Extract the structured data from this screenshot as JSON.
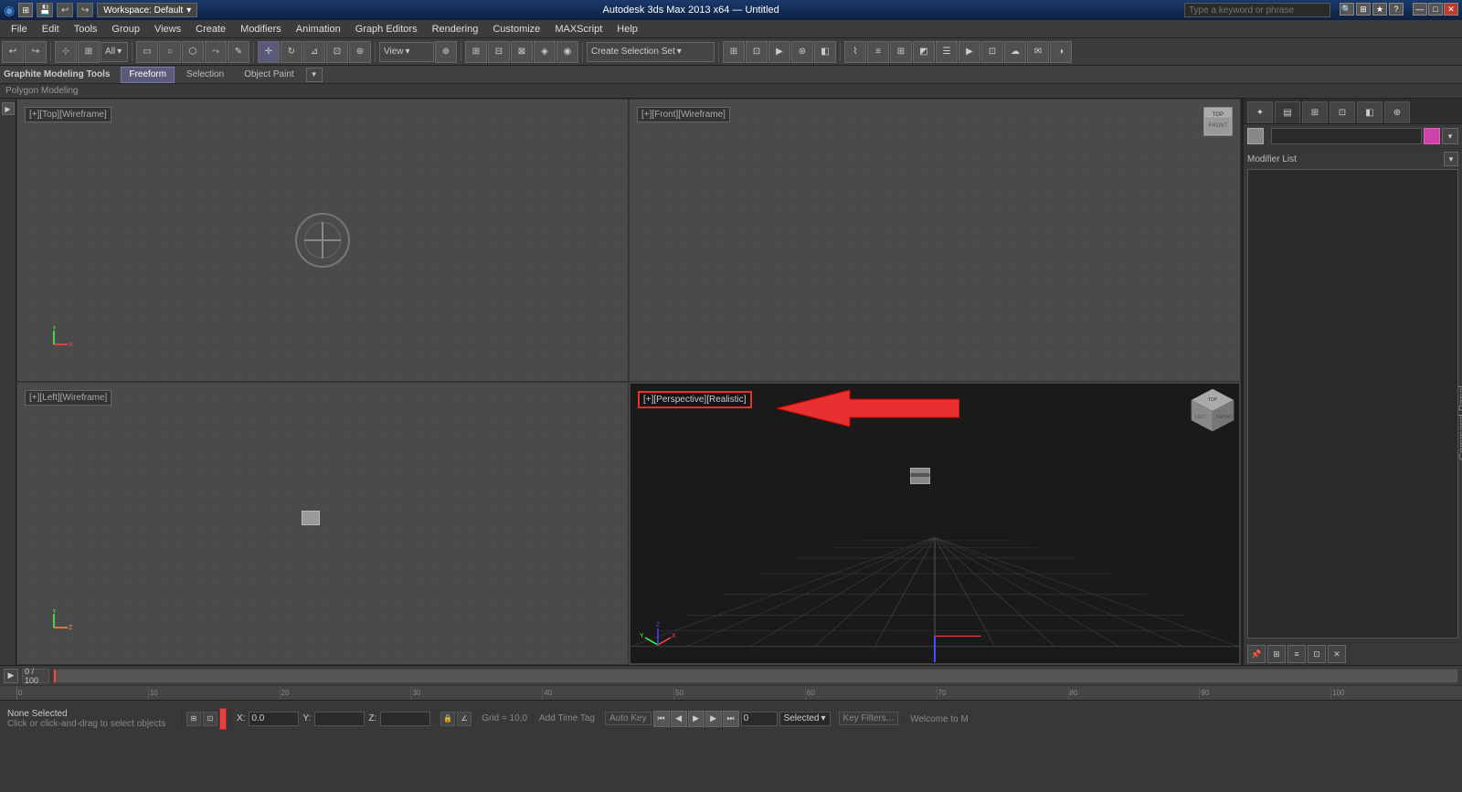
{
  "titlebar": {
    "logo": "◉",
    "title": "Autodesk 3ds Max 2013 x64 — Untitled",
    "workspace_label": "Workspace: Default",
    "search_placeholder": "Type a keyword or phrase",
    "controls": [
      "—",
      "□",
      "✕"
    ]
  },
  "menu": {
    "items": [
      "File",
      "Edit",
      "Tools",
      "Group",
      "Views",
      "Create",
      "Modifiers",
      "Animation",
      "Graph Editors",
      "Rendering",
      "Customize",
      "MAXScript",
      "Help"
    ]
  },
  "toolbar": {
    "view_dropdown": "View",
    "view_dropdown2": "All",
    "create_dropdown": "Create Selection Set",
    "buttons": [
      "undo",
      "redo",
      "select",
      "select-region",
      "lasso",
      "paint",
      "move",
      "rotate",
      "scale",
      "uniform-scale",
      "select-center",
      "coord-system",
      "use-transform-center",
      "mirror",
      "align",
      "quick-align",
      "normal-align",
      "place-highlight",
      "snap-angle",
      "snap-percent",
      "named-selections",
      "curve",
      "sound",
      "effects",
      "rendering",
      "environment",
      "material-editor",
      "render-scene",
      "quick-render"
    ]
  },
  "secondary_toolbar": {
    "title": "Graphite Modeling Tools",
    "tabs": [
      "Freeform",
      "Selection",
      "Object Paint"
    ],
    "extra_btn": "▾"
  },
  "polygon_label": "Polygon Modeling",
  "viewports": {
    "top": {
      "label": "[+][Top][Wireframe]",
      "has_object": false
    },
    "front": {
      "label": "[+][Front][Wireframe]",
      "has_object": false
    },
    "left": {
      "label": "[+][Left][Wireframe]",
      "has_small_obj": true
    },
    "perspective": {
      "label": "[+][Perspective][Realistic]",
      "highlighted": true,
      "has_grid": true
    }
  },
  "annotation": {
    "arrow_text": "←",
    "label": "Command Panel"
  },
  "command_panel": {
    "label": "Command Panel",
    "tabs": [
      "create",
      "modify",
      "hierarchy",
      "motion",
      "display",
      "utilities"
    ],
    "tab_icons": [
      "✦",
      "▤",
      "⊞",
      "⊡",
      "◧",
      "⊕"
    ],
    "modifier_list_label": "Modifier List",
    "color_swatches": [
      "#888888",
      "#ff44aa"
    ]
  },
  "timeline": {
    "current_frame": "0 / 100",
    "start": "0",
    "end": "100"
  },
  "ruler": {
    "marks": [
      "0",
      "10",
      "20",
      "30",
      "40",
      "50",
      "60",
      "70",
      "80",
      "90",
      "100"
    ]
  },
  "status_bar": {
    "selection_label": "None Selected",
    "hint": "Click or click-and-drag to select objects",
    "coords": {
      "x_label": "X:",
      "x_value": "0.0",
      "y_label": "Y:",
      "y_value": "",
      "z_label": "Z:",
      "z_value": ""
    },
    "grid_label": "Grid = 10,0",
    "autokey_label": "Auto Key",
    "selected_label": "Selected",
    "time_tag": "Add Time Tag",
    "key_filters": "Key Filters...",
    "welcome": "Welcome to M"
  },
  "bottom_controls": {
    "play_btns": [
      "⏮",
      "◀",
      "◀◀",
      "▶",
      "▶▶",
      "▶|",
      "⏭"
    ]
  }
}
